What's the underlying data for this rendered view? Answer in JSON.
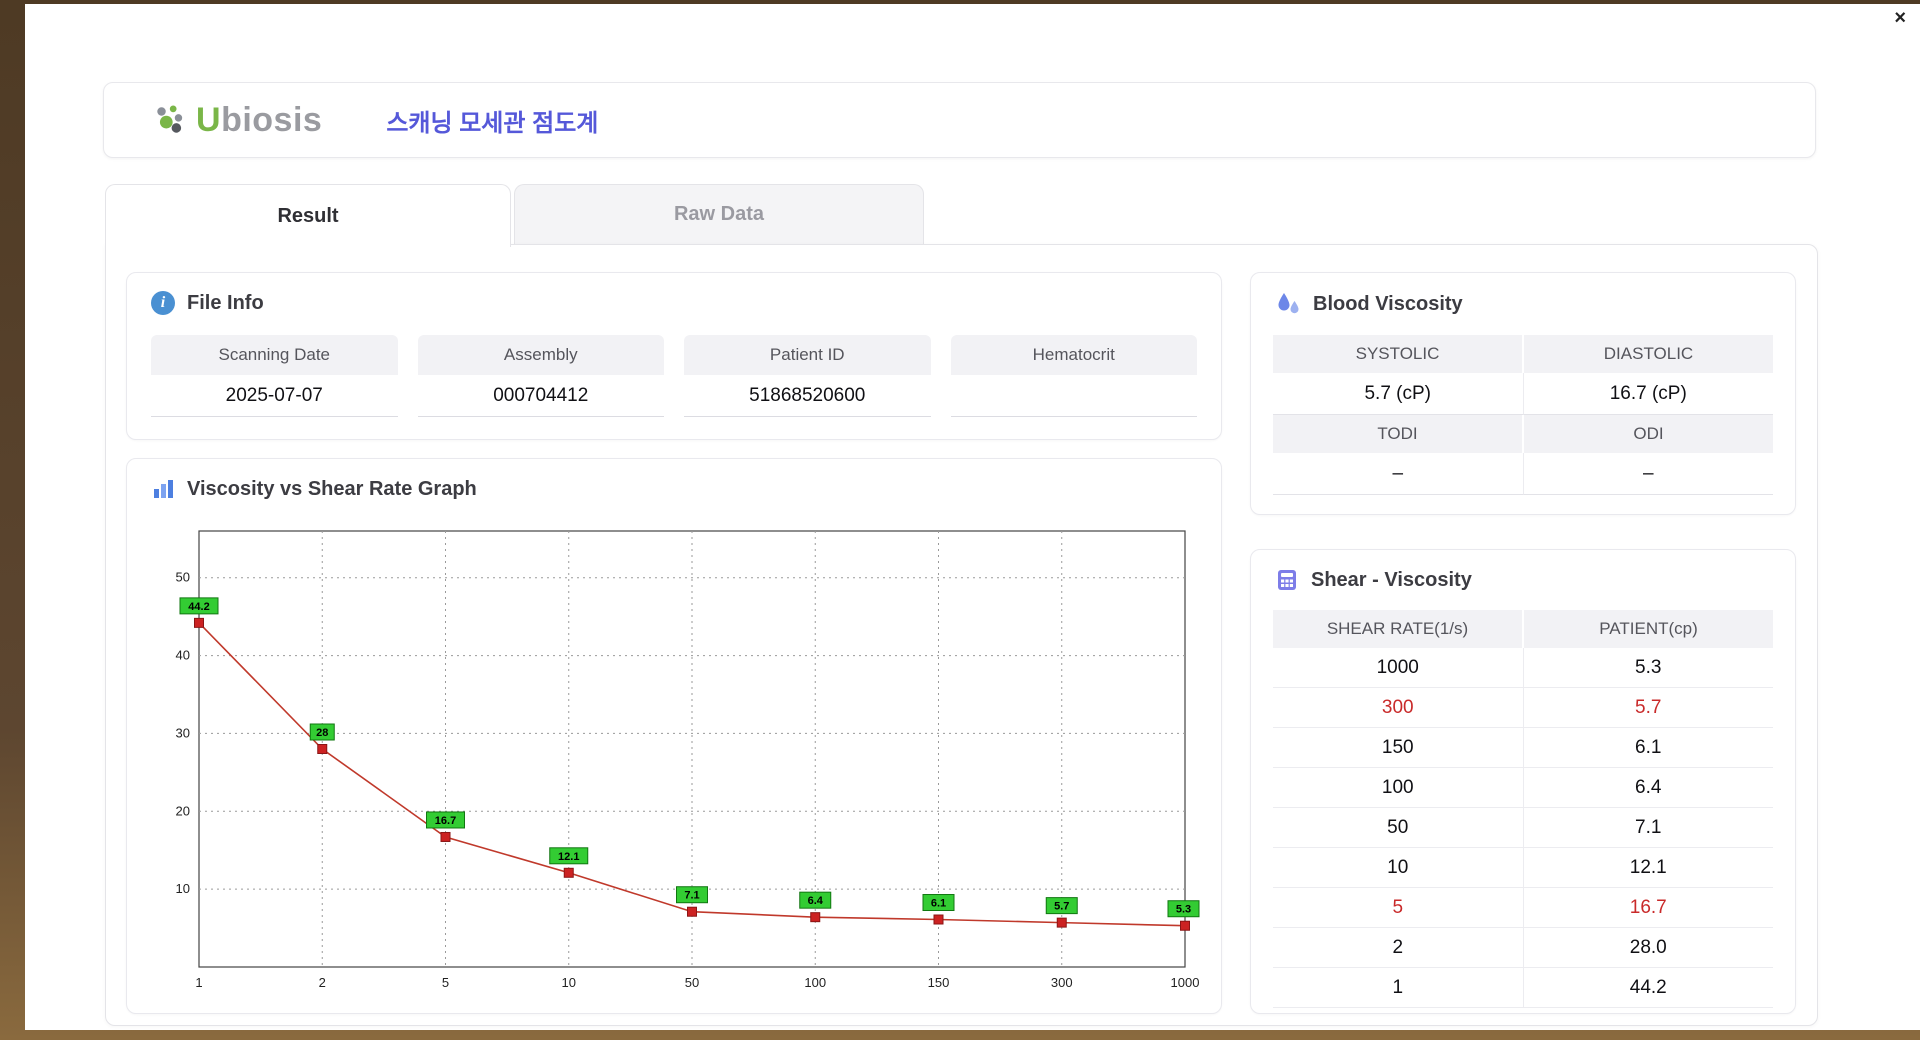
{
  "window": {
    "close_label": "×"
  },
  "header": {
    "logo_text": "Ubiosis",
    "title": "스캐닝 모세관 점도계"
  },
  "tabs": [
    {
      "label": "Result",
      "active": true
    },
    {
      "label": "Raw Data",
      "active": false
    }
  ],
  "file_info": {
    "title": "File Info",
    "fields": [
      {
        "label": "Scanning Date",
        "value": "2025-07-07"
      },
      {
        "label": "Assembly",
        "value": "000704412"
      },
      {
        "label": "Patient ID",
        "value": "51868520600"
      },
      {
        "label": "Hematocrit",
        "value": ""
      }
    ]
  },
  "blood_viscosity": {
    "title": "Blood Viscosity",
    "row1": [
      {
        "label": "SYSTOLIC",
        "value": "5.7 (cP)"
      },
      {
        "label": "DIASTOLIC",
        "value": "16.7 (cP)"
      }
    ],
    "row2": [
      {
        "label": "TODI",
        "value": "–"
      },
      {
        "label": "ODI",
        "value": "–"
      }
    ]
  },
  "graph": {
    "title": "Viscosity vs Shear Rate Graph"
  },
  "chart_data": {
    "type": "line",
    "title": "Viscosity vs Shear Rate Graph",
    "x_ticks": [
      "1",
      "2",
      "5",
      "10",
      "50",
      "100",
      "150",
      "300",
      "1000"
    ],
    "x": [
      1,
      2,
      5,
      10,
      50,
      100,
      150,
      300,
      1000
    ],
    "values": [
      44.2,
      28,
      16.7,
      12.1,
      7.1,
      6.4,
      6.1,
      5.7,
      5.3
    ],
    "point_labels": [
      "44.2",
      "28",
      "16.7",
      "12.1",
      "7.1",
      "6.4",
      "6.1",
      "5.7",
      "5.3"
    ],
    "y_ticks": [
      10,
      20,
      30,
      40,
      50
    ],
    "y_max": 56,
    "x_scale": "log (ticks equally spaced)",
    "grid": "dotted",
    "line_color": "#c0392b",
    "marker_color": "#cc2222",
    "label_bg": "#33cc33",
    "label_border": "#117711"
  },
  "shear_table": {
    "title": "Shear - Viscosity",
    "columns": [
      "SHEAR RATE(1/s)",
      "PATIENT(cp)"
    ],
    "rows": [
      {
        "rate": "1000",
        "value": "5.3",
        "highlight": false
      },
      {
        "rate": "300",
        "value": "5.7",
        "highlight": true
      },
      {
        "rate": "150",
        "value": "6.1",
        "highlight": false
      },
      {
        "rate": "100",
        "value": "6.4",
        "highlight": false
      },
      {
        "rate": "50",
        "value": "7.1",
        "highlight": false
      },
      {
        "rate": "10",
        "value": "12.1",
        "highlight": false
      },
      {
        "rate": "5",
        "value": "16.7",
        "highlight": true
      },
      {
        "rate": "2",
        "value": "28.0",
        "highlight": false
      },
      {
        "rate": "1",
        "value": "44.2",
        "highlight": false
      }
    ]
  },
  "icons": {
    "file_info": "info-circle-icon",
    "blood_viscosity": "droplets-icon",
    "graph": "bar-chart-icon",
    "shear": "calculator-icon",
    "logo": "leaf-dots-icon",
    "close": "close-icon"
  },
  "colors": {
    "accent_blue": "#5558d9",
    "logo_green": "#7ab648",
    "highlight_red": "#c92a2a",
    "header_gray": "#f2f2f5",
    "frame_brown": "#5d4630"
  }
}
